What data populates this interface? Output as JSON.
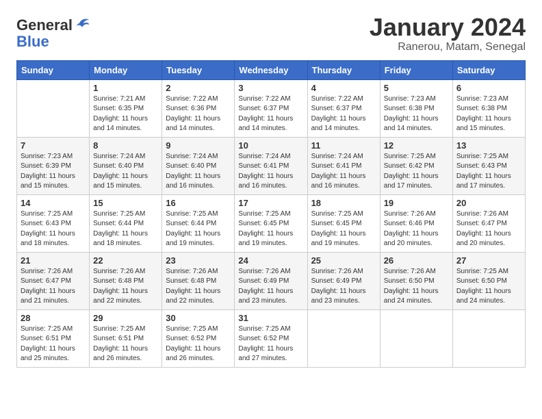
{
  "header": {
    "logo_general": "General",
    "logo_blue": "Blue",
    "title": "January 2024",
    "location": "Ranerou, Matam, Senegal"
  },
  "days_of_week": [
    "Sunday",
    "Monday",
    "Tuesday",
    "Wednesday",
    "Thursday",
    "Friday",
    "Saturday"
  ],
  "weeks": [
    [
      {
        "day": "",
        "sunrise": "",
        "sunset": "",
        "daylight": ""
      },
      {
        "day": "1",
        "sunrise": "7:21 AM",
        "sunset": "6:35 PM",
        "daylight": "11 hours and 14 minutes."
      },
      {
        "day": "2",
        "sunrise": "7:22 AM",
        "sunset": "6:36 PM",
        "daylight": "11 hours and 14 minutes."
      },
      {
        "day": "3",
        "sunrise": "7:22 AM",
        "sunset": "6:37 PM",
        "daylight": "11 hours and 14 minutes."
      },
      {
        "day": "4",
        "sunrise": "7:22 AM",
        "sunset": "6:37 PM",
        "daylight": "11 hours and 14 minutes."
      },
      {
        "day": "5",
        "sunrise": "7:23 AM",
        "sunset": "6:38 PM",
        "daylight": "11 hours and 14 minutes."
      },
      {
        "day": "6",
        "sunrise": "7:23 AM",
        "sunset": "6:38 PM",
        "daylight": "11 hours and 15 minutes."
      }
    ],
    [
      {
        "day": "7",
        "sunrise": "7:23 AM",
        "sunset": "6:39 PM",
        "daylight": "11 hours and 15 minutes."
      },
      {
        "day": "8",
        "sunrise": "7:24 AM",
        "sunset": "6:40 PM",
        "daylight": "11 hours and 15 minutes."
      },
      {
        "day": "9",
        "sunrise": "7:24 AM",
        "sunset": "6:40 PM",
        "daylight": "11 hours and 16 minutes."
      },
      {
        "day": "10",
        "sunrise": "7:24 AM",
        "sunset": "6:41 PM",
        "daylight": "11 hours and 16 minutes."
      },
      {
        "day": "11",
        "sunrise": "7:24 AM",
        "sunset": "6:41 PM",
        "daylight": "11 hours and 16 minutes."
      },
      {
        "day": "12",
        "sunrise": "7:25 AM",
        "sunset": "6:42 PM",
        "daylight": "11 hours and 17 minutes."
      },
      {
        "day": "13",
        "sunrise": "7:25 AM",
        "sunset": "6:43 PM",
        "daylight": "11 hours and 17 minutes."
      }
    ],
    [
      {
        "day": "14",
        "sunrise": "7:25 AM",
        "sunset": "6:43 PM",
        "daylight": "11 hours and 18 minutes."
      },
      {
        "day": "15",
        "sunrise": "7:25 AM",
        "sunset": "6:44 PM",
        "daylight": "11 hours and 18 minutes."
      },
      {
        "day": "16",
        "sunrise": "7:25 AM",
        "sunset": "6:44 PM",
        "daylight": "11 hours and 19 minutes."
      },
      {
        "day": "17",
        "sunrise": "7:25 AM",
        "sunset": "6:45 PM",
        "daylight": "11 hours and 19 minutes."
      },
      {
        "day": "18",
        "sunrise": "7:25 AM",
        "sunset": "6:45 PM",
        "daylight": "11 hours and 19 minutes."
      },
      {
        "day": "19",
        "sunrise": "7:26 AM",
        "sunset": "6:46 PM",
        "daylight": "11 hours and 20 minutes."
      },
      {
        "day": "20",
        "sunrise": "7:26 AM",
        "sunset": "6:47 PM",
        "daylight": "11 hours and 20 minutes."
      }
    ],
    [
      {
        "day": "21",
        "sunrise": "7:26 AM",
        "sunset": "6:47 PM",
        "daylight": "11 hours and 21 minutes."
      },
      {
        "day": "22",
        "sunrise": "7:26 AM",
        "sunset": "6:48 PM",
        "daylight": "11 hours and 22 minutes."
      },
      {
        "day": "23",
        "sunrise": "7:26 AM",
        "sunset": "6:48 PM",
        "daylight": "11 hours and 22 minutes."
      },
      {
        "day": "24",
        "sunrise": "7:26 AM",
        "sunset": "6:49 PM",
        "daylight": "11 hours and 23 minutes."
      },
      {
        "day": "25",
        "sunrise": "7:26 AM",
        "sunset": "6:49 PM",
        "daylight": "11 hours and 23 minutes."
      },
      {
        "day": "26",
        "sunrise": "7:26 AM",
        "sunset": "6:50 PM",
        "daylight": "11 hours and 24 minutes."
      },
      {
        "day": "27",
        "sunrise": "7:25 AM",
        "sunset": "6:50 PM",
        "daylight": "11 hours and 24 minutes."
      }
    ],
    [
      {
        "day": "28",
        "sunrise": "7:25 AM",
        "sunset": "6:51 PM",
        "daylight": "11 hours and 25 minutes."
      },
      {
        "day": "29",
        "sunrise": "7:25 AM",
        "sunset": "6:51 PM",
        "daylight": "11 hours and 26 minutes."
      },
      {
        "day": "30",
        "sunrise": "7:25 AM",
        "sunset": "6:52 PM",
        "daylight": "11 hours and 26 minutes."
      },
      {
        "day": "31",
        "sunrise": "7:25 AM",
        "sunset": "6:52 PM",
        "daylight": "11 hours and 27 minutes."
      },
      {
        "day": "",
        "sunrise": "",
        "sunset": "",
        "daylight": ""
      },
      {
        "day": "",
        "sunrise": "",
        "sunset": "",
        "daylight": ""
      },
      {
        "day": "",
        "sunrise": "",
        "sunset": "",
        "daylight": ""
      }
    ]
  ]
}
